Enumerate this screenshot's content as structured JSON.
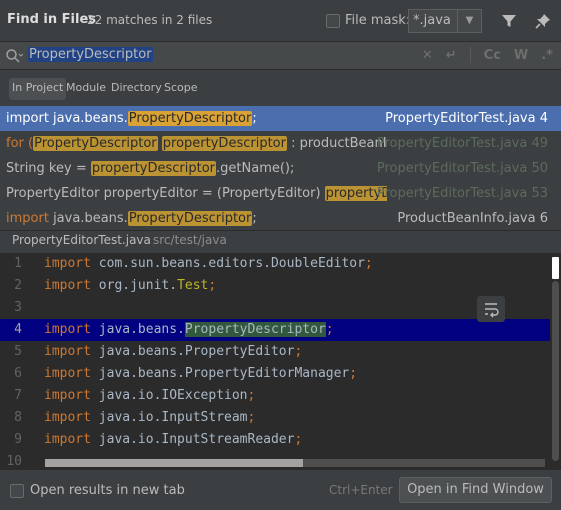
{
  "header": {
    "title": "Find in Files",
    "matches": "22 matches in 2 files",
    "file_mask_label": "File mask:",
    "file_mask_value": "*.java"
  },
  "search": {
    "query": "PropertyDescriptor",
    "option_cc": "Cc",
    "option_w": "W",
    "option_regex": ".*"
  },
  "scopes": [
    {
      "label": "In Project",
      "mnemonic": "P"
    },
    {
      "label": "Module",
      "mnemonic": "M"
    },
    {
      "label": "Directory",
      "mnemonic": "D"
    },
    {
      "label": "Scope",
      "mnemonic": "S"
    }
  ],
  "results": [
    {
      "parts": [
        {
          "t": "import java.beans."
        },
        {
          "t": "PropertyDescriptor",
          "hl": true
        },
        {
          "t": ";"
        }
      ],
      "location": "PropertyEditorTest.java 4",
      "selected": true
    },
    {
      "parts": [
        {
          "t": "for (",
          "kw": true
        },
        {
          "t": "PropertyDescriptor",
          "hl": true
        },
        {
          "t": " "
        },
        {
          "t": "propertyDescriptor",
          "hl": true
        },
        {
          "t": " : productBeanInfo.get"
        }
      ],
      "location": "PropertyEditorTest.java 49",
      "dim": true
    },
    {
      "parts": [
        {
          "t": "String key = "
        },
        {
          "t": "propertyDescriptor",
          "hl": true
        },
        {
          "t": ".getName();"
        }
      ],
      "location": "PropertyEditorTest.java 50",
      "dim": true
    },
    {
      "parts": [
        {
          "t": "PropertyEditor propertyEditor = (PropertyEditor) "
        },
        {
          "t": "propertyDescrip",
          "hl": true
        }
      ],
      "location": "PropertyEditorTest.java 53",
      "dim": true
    },
    {
      "parts": [
        {
          "t": "import",
          "kw": true
        },
        {
          "t": " java.beans."
        },
        {
          "t": "PropertyDescriptor",
          "hl": true
        },
        {
          "t": ";"
        }
      ],
      "location": "ProductBeanInfo.java 6"
    }
  ],
  "preview": {
    "file": "PropertyEditorTest.java",
    "path": "src/test/java"
  },
  "code_lines": [
    {
      "n": "1",
      "tokens": [
        {
          "t": "import",
          "c": "k"
        },
        {
          "t": " com.sun.beans.editors.DoubleEditor"
        },
        {
          "t": ";",
          "c": "semi"
        }
      ]
    },
    {
      "n": "2",
      "tokens": [
        {
          "t": "import",
          "c": "k"
        },
        {
          "t": " org.junit."
        },
        {
          "t": "Test",
          "c": "cls"
        },
        {
          "t": ";",
          "c": "semi"
        }
      ]
    },
    {
      "n": "3",
      "tokens": []
    },
    {
      "n": "4",
      "current": true,
      "tokens": [
        {
          "t": "import",
          "c": "k"
        },
        {
          "t": " java.beans."
        },
        {
          "t": "PropertyDescriptor",
          "c": "match"
        },
        {
          "t": ";",
          "c": "semi"
        }
      ]
    },
    {
      "n": "5",
      "tokens": [
        {
          "t": "import",
          "c": "k"
        },
        {
          "t": " java.beans.PropertyEditor"
        },
        {
          "t": ";",
          "c": "semi"
        }
      ]
    },
    {
      "n": "6",
      "tokens": [
        {
          "t": "import",
          "c": "k"
        },
        {
          "t": " java.beans.PropertyEditorManager"
        },
        {
          "t": ";",
          "c": "semi"
        }
      ]
    },
    {
      "n": "7",
      "tokens": [
        {
          "t": "import",
          "c": "k"
        },
        {
          "t": " java.io.IOException"
        },
        {
          "t": ";",
          "c": "semi"
        }
      ]
    },
    {
      "n": "8",
      "tokens": [
        {
          "t": "import",
          "c": "k"
        },
        {
          "t": " java.io.InputStream"
        },
        {
          "t": ";",
          "c": "semi"
        }
      ]
    },
    {
      "n": "9",
      "tokens": [
        {
          "t": "import",
          "c": "k"
        },
        {
          "t": " java.io.InputStreamReader"
        },
        {
          "t": ";",
          "c": "semi"
        }
      ]
    },
    {
      "n": "10",
      "tokens": []
    }
  ],
  "footer": {
    "open_new_tab": "Open results in new tab",
    "shortcut": "Ctrl+Enter",
    "open_button": "Open in Find Window"
  },
  "icons": {
    "filter": "filter-icon",
    "pin": "pin-icon",
    "search": "search-icon",
    "clear": "close-icon",
    "newline": "newline-icon",
    "soft_wrap": "soft-wrap-icon"
  }
}
